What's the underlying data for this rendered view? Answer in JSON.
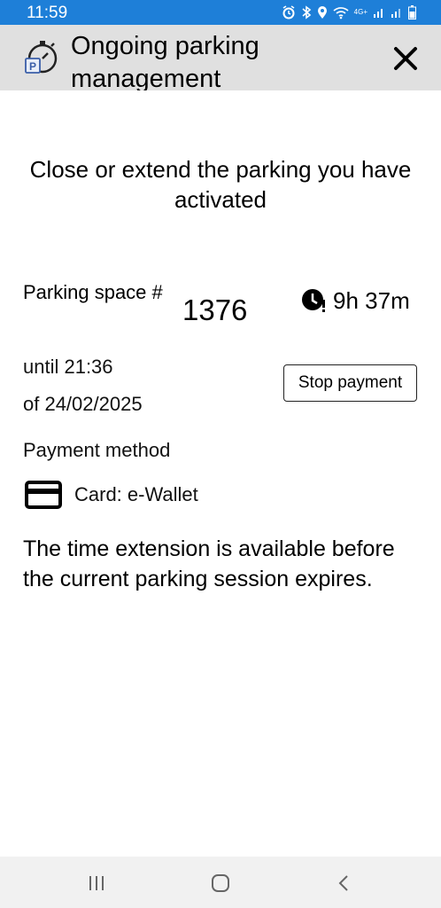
{
  "status_bar": {
    "time": "11:59",
    "network": "4G+"
  },
  "header": {
    "title": "Ongoing parking management",
    "icon": "parking-timer-icon",
    "close_icon": "close-icon"
  },
  "main": {
    "subtitle": "Close or extend the parking you have activated",
    "parking_space_label": "Parking space #",
    "parking_space_number": "1376",
    "remaining_time": "9h 37m",
    "until_text": "until 21:36",
    "date_text": "of 24/02/2025",
    "stop_button_label": "Stop payment",
    "payment_method_label": "Payment method",
    "payment_card": "Card: e-Wallet",
    "info_text": "The time extension is available before the current parking session expires."
  },
  "nav": {
    "recent": "recent-apps-icon",
    "home": "home-icon",
    "back": "back-icon"
  }
}
